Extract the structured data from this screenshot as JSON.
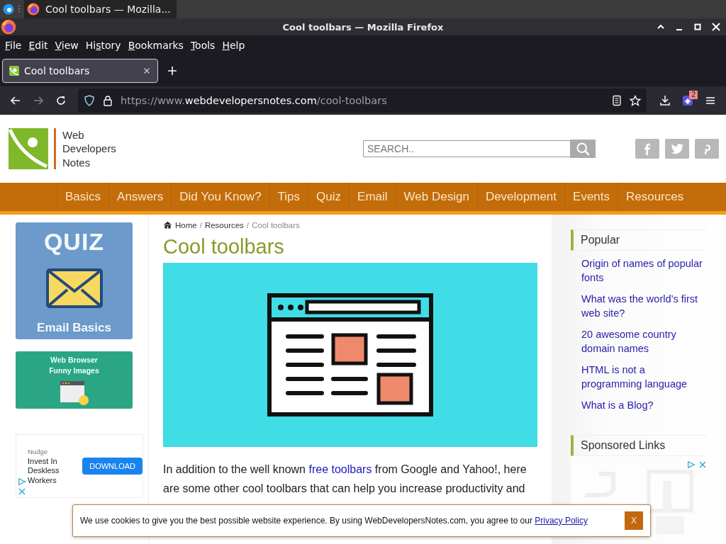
{
  "taskbar": {
    "task_title": "Cool toolbars — Mozilla..."
  },
  "window": {
    "title": "Cool toolbars — Mozilla Firefox"
  },
  "menu": [
    {
      "key": "F",
      "after": "ile"
    },
    {
      "key": "E",
      "after": "dit"
    },
    {
      "key": "V",
      "after": "iew"
    },
    {
      "before": "Hi",
      "key": "s",
      "after": "tory"
    },
    {
      "key": "B",
      "after": "ookmarks"
    },
    {
      "key": "T",
      "after": "ools"
    },
    {
      "key": "H",
      "after": "elp"
    }
  ],
  "tabs": [
    {
      "label": "Cool toolbars",
      "selected": true
    }
  ],
  "navigation": {
    "back_disabled": false,
    "forward_disabled": true,
    "url_prefix": "https://www.",
    "url_domain": "webdevelopersnotes.com",
    "url_path": "/cool-toolbars",
    "extension_badge": "2"
  },
  "site": {
    "logo": [
      "Web",
      "Developers",
      "Notes"
    ],
    "search": {
      "placeholder": "SEARCH.."
    },
    "nav": [
      "Basics",
      "Answers",
      "Did You Know?",
      "Tips",
      "Quiz",
      "Email",
      "Web Design",
      "Development",
      "Events",
      "Resources"
    ]
  },
  "left_column": {
    "quiz_card": {
      "heading": "QUIZ",
      "caption": "Email Basics"
    },
    "browser_card": {
      "lines": [
        "Web Browser",
        "Funny Images"
      ]
    },
    "ad": {
      "brand": "Nudge",
      "headline": "Invest In Deskless Workers",
      "button": "DOWNLOAD"
    }
  },
  "article": {
    "breadcrumb": [
      {
        "label": "Home",
        "kind": "link"
      },
      {
        "separator": "/",
        "label": "Resources",
        "kind": "link"
      },
      {
        "separator": "/",
        "label": "Cool toolbars",
        "kind": "current"
      }
    ],
    "title": "Cool toolbars",
    "intro_before": "In addition to the well known ",
    "intro_link": "free toolbars",
    "intro_after": " from Google and Yahoo!, here are some other cool toolbars that can help you increase productivity and"
  },
  "sidebar": {
    "popular_title": "Popular",
    "popular": [
      "Origin of names of popular fonts",
      "What was the world’s first web site?",
      "20 awesome country domain names",
      "HTML is not a programming language",
      "What is a Blog?"
    ],
    "sponsored_title": "Sponsored Links"
  },
  "cookie_banner": {
    "text": "We use cookies to give you the best possible website experience. By using WebDevelopersNotes.com, you agree to our ",
    "link": "Privacy Policy",
    "close": "X"
  }
}
